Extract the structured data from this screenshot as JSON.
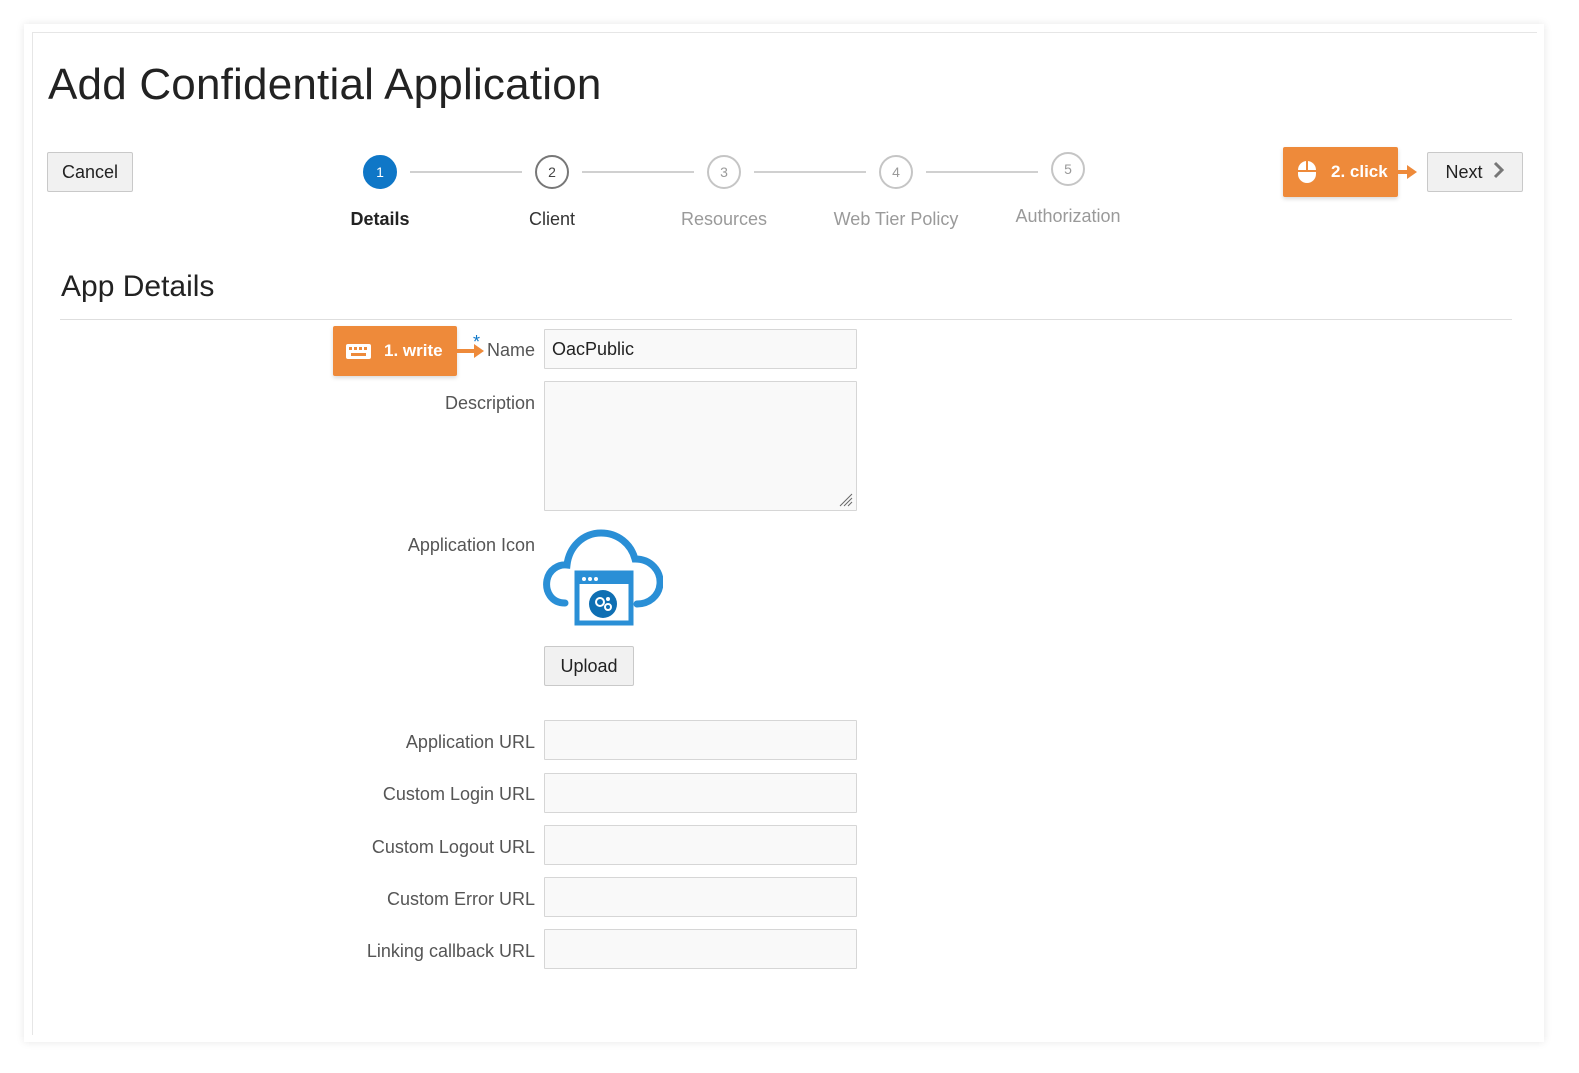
{
  "page": {
    "title": "Add Confidential Application"
  },
  "toolbar": {
    "cancel_label": "Cancel",
    "next_label": "Next"
  },
  "stepper": {
    "steps": [
      {
        "number": "1",
        "label": "Details",
        "state": "active"
      },
      {
        "number": "2",
        "label": "Client",
        "state": "done"
      },
      {
        "number": "3",
        "label": "Resources",
        "state": "pending"
      },
      {
        "number": "4",
        "label": "Web Tier Policy",
        "state": "pending"
      },
      {
        "number": "5",
        "label": "Authorization",
        "state": "pending"
      }
    ]
  },
  "callouts": {
    "write": {
      "label": "1. write",
      "icon": "keyboard-icon"
    },
    "click": {
      "label": "2. click",
      "icon": "mouse-icon"
    }
  },
  "section": {
    "title": "App Details"
  },
  "form": {
    "name": {
      "label": "Name",
      "value": "OacPublic",
      "required": true
    },
    "description": {
      "label": "Description",
      "value": ""
    },
    "icon": {
      "label": "Application Icon",
      "icon": "cloud-app-icon"
    },
    "upload_label": "Upload",
    "application_url": {
      "label": "Application URL",
      "value": ""
    },
    "custom_login_url": {
      "label": "Custom Login URL",
      "value": ""
    },
    "custom_logout_url": {
      "label": "Custom Logout URL",
      "value": ""
    },
    "custom_error_url": {
      "label": "Custom Error URL",
      "value": ""
    },
    "linking_callback_url": {
      "label": "Linking callback URL",
      "value": ""
    }
  },
  "colors": {
    "accent": "#0f77c7",
    "callout": "#ee8a3a",
    "icon_blue": "#2a8fd6"
  }
}
